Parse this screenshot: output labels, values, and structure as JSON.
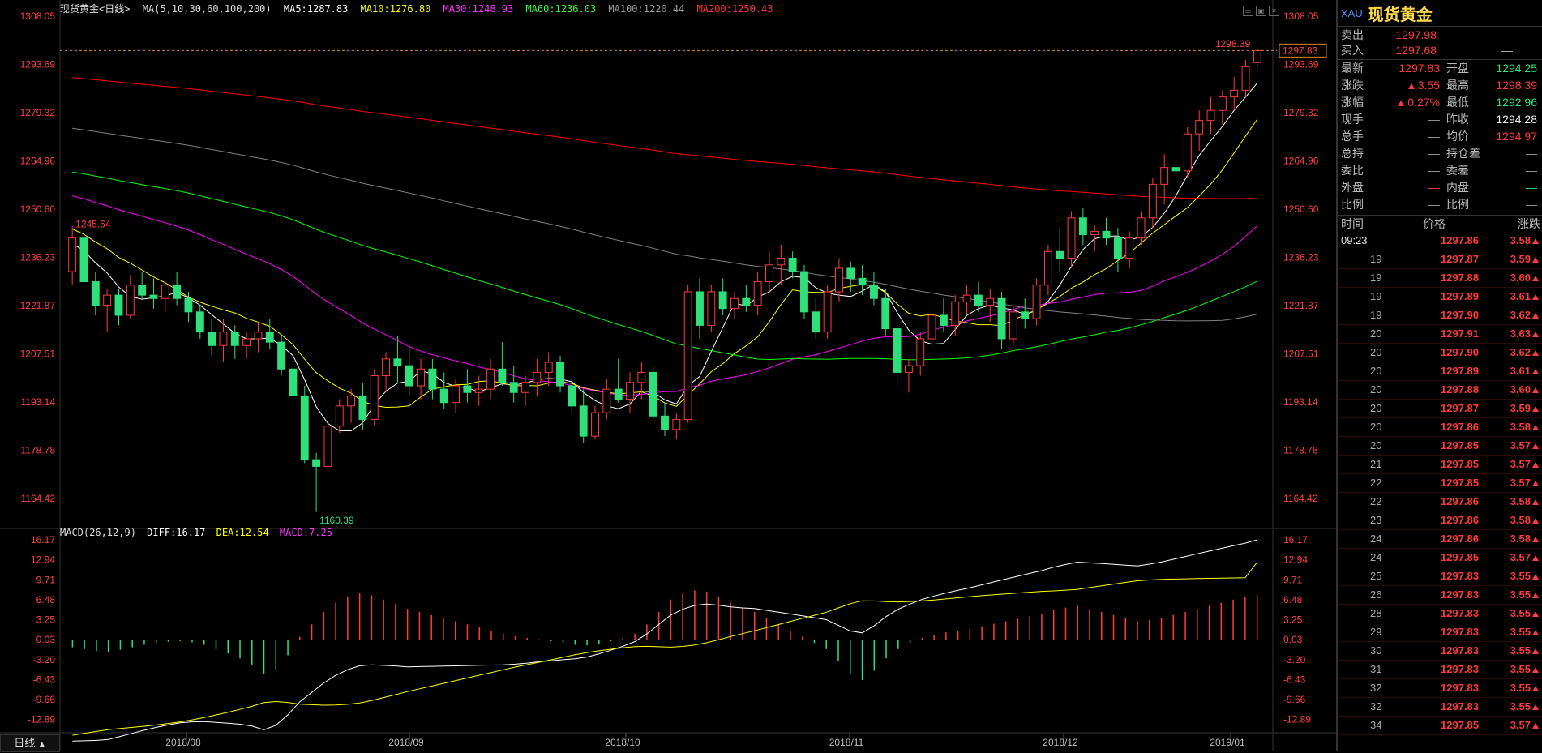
{
  "header": {
    "instrument": "现货黄金<日线>",
    "ma_params": "MA(5,10,30,60,100,200)",
    "ma5": "MA5:1287.83",
    "ma10": "MA10:1276.80",
    "ma30": "MA30:1248.93",
    "ma60": "MA60:1236.03",
    "ma100": "MA100:1220.44",
    "ma200": "MA200:1250.43"
  },
  "price_axis": [
    "1308.05",
    "1293.69",
    "1279.32",
    "1264.96",
    "1250.60",
    "1236.23",
    "1221.87",
    "1207.51",
    "1193.14",
    "1178.78",
    "1164.42"
  ],
  "macd_axis": [
    "16.17",
    "12.94",
    "9.71",
    "6.48",
    "3.25",
    "0.03",
    "-3.20",
    "-6.43",
    "-9.66",
    "-12.89"
  ],
  "date_axis": [
    "2018/08",
    "2018/09",
    "2018/10",
    "2018/11",
    "2018/12",
    "2019/01"
  ],
  "annotations": {
    "high_label": "1298.39",
    "low_label": "1160.39",
    "early_high": "1245.64",
    "last_price_tag": "1297.83"
  },
  "macd_header": {
    "name": "MACD(26,12,9)",
    "diff": "DIFF:16.17",
    "dea": "DEA:12.54",
    "macd": "MACD:7.25"
  },
  "period_button": "日线",
  "colors": {
    "up": "#ff3b3b",
    "down": "#2ee07a",
    "ma5": "#ffffff",
    "ma10": "#ffff00",
    "ma30": "#ff00ff",
    "ma60": "#00ff00",
    "ma100": "#808080",
    "ma200": "#ff0000"
  },
  "panel": {
    "code": "XAU",
    "name": "现货黄金",
    "sell_label": "卖出",
    "sell_price": "1297.98",
    "sell_vol": "—",
    "buy_label": "买入",
    "buy_price": "1297.68",
    "buy_vol": "—",
    "stats": [
      {
        "l1": "最新",
        "v1": "1297.83",
        "c1": "red",
        "l2": "开盘",
        "v2": "1294.25",
        "c2": "green"
      },
      {
        "l1": "涨跌",
        "v1": "3.55",
        "c1": "red",
        "l2": "最高",
        "v2": "1298.39",
        "c2": "red"
      },
      {
        "l1": "涨幅",
        "v1": "0.27%",
        "c1": "red",
        "l2": "最低",
        "v2": "1292.96",
        "c2": "green"
      },
      {
        "l1": "现手",
        "v1": "—",
        "c1": "gray",
        "l2": "昨收",
        "v2": "1294.28",
        "c2": "white"
      },
      {
        "l1": "总手",
        "v1": "—",
        "c1": "gray",
        "l2": "均价",
        "v2": "1294.97",
        "c2": "red"
      },
      {
        "l1": "总持",
        "v1": "—",
        "c1": "gray",
        "l2": "持仓差",
        "v2": "—",
        "c2": "gray"
      },
      {
        "l1": "委比",
        "v1": "—",
        "c1": "gray",
        "l2": "委差",
        "v2": "—",
        "c2": "gray"
      },
      {
        "l1": "外盘",
        "v1": "—",
        "c1": "red",
        "l2": "内盘",
        "v2": "—",
        "c2": "green"
      },
      {
        "l1": "比例",
        "v1": "—",
        "c1": "gray",
        "l2": "比例",
        "v2": "—",
        "c2": "gray"
      }
    ],
    "tick_headers": [
      "时间",
      "价格",
      "涨跌"
    ],
    "ticks": [
      {
        "t": "09:23",
        "p": "1297.86",
        "c": "3.58"
      },
      {
        "t": "19",
        "p": "1297.87",
        "c": "3.59"
      },
      {
        "t": "19",
        "p": "1297.88",
        "c": "3.60"
      },
      {
        "t": "19",
        "p": "1297.89",
        "c": "3.61"
      },
      {
        "t": "19",
        "p": "1297.90",
        "c": "3.62"
      },
      {
        "t": "20",
        "p": "1297.91",
        "c": "3.63"
      },
      {
        "t": "20",
        "p": "1297.90",
        "c": "3.62"
      },
      {
        "t": "20",
        "p": "1297.89",
        "c": "3.61"
      },
      {
        "t": "20",
        "p": "1297.88",
        "c": "3.60"
      },
      {
        "t": "20",
        "p": "1297.87",
        "c": "3.59"
      },
      {
        "t": "20",
        "p": "1297.86",
        "c": "3.58"
      },
      {
        "t": "20",
        "p": "1297.85",
        "c": "3.57"
      },
      {
        "t": "21",
        "p": "1297.85",
        "c": "3.57"
      },
      {
        "t": "22",
        "p": "1297.85",
        "c": "3.57"
      },
      {
        "t": "22",
        "p": "1297.86",
        "c": "3.58"
      },
      {
        "t": "23",
        "p": "1297.86",
        "c": "3.58"
      },
      {
        "t": "24",
        "p": "1297.86",
        "c": "3.58"
      },
      {
        "t": "24",
        "p": "1297.85",
        "c": "3.57"
      },
      {
        "t": "25",
        "p": "1297.83",
        "c": "3.55"
      },
      {
        "t": "26",
        "p": "1297.83",
        "c": "3.55"
      },
      {
        "t": "28",
        "p": "1297.83",
        "c": "3.55"
      },
      {
        "t": "29",
        "p": "1297.83",
        "c": "3.55"
      },
      {
        "t": "30",
        "p": "1297.83",
        "c": "3.55"
      },
      {
        "t": "31",
        "p": "1297.83",
        "c": "3.55"
      },
      {
        "t": "32",
        "p": "1297.83",
        "c": "3.55"
      },
      {
        "t": "32",
        "p": "1297.83",
        "c": "3.55"
      },
      {
        "t": "34",
        "p": "1297.85",
        "c": "3.57"
      }
    ]
  },
  "chart_data": {
    "type": "candlestick",
    "xlabel": "",
    "ylabel": "",
    "ylim": [
      1160,
      1308.05
    ],
    "date_labels": [
      "2018/08",
      "2018/09",
      "2018/10",
      "2018/11",
      "2018/12",
      "2019/01"
    ],
    "ohlc": [
      [
        1232,
        1245.6,
        1228,
        1242
      ],
      [
        1242,
        1244,
        1227,
        1229
      ],
      [
        1229,
        1232,
        1219,
        1222
      ],
      [
        1222,
        1227,
        1214,
        1225
      ],
      [
        1225,
        1227,
        1216,
        1219
      ],
      [
        1219,
        1231,
        1218,
        1228
      ],
      [
        1228,
        1232,
        1224,
        1225
      ],
      [
        1225,
        1230,
        1221,
        1224
      ],
      [
        1224,
        1229,
        1220,
        1228
      ],
      [
        1228,
        1232,
        1222,
        1224
      ],
      [
        1224,
        1226,
        1217,
        1220
      ],
      [
        1220,
        1222,
        1212,
        1214
      ],
      [
        1214,
        1218,
        1207,
        1210
      ],
      [
        1210,
        1218,
        1205,
        1214
      ],
      [
        1214,
        1216,
        1206,
        1210
      ],
      [
        1210,
        1214,
        1206,
        1212
      ],
      [
        1212,
        1217,
        1208,
        1214
      ],
      [
        1214,
        1218,
        1209,
        1211
      ],
      [
        1211,
        1213,
        1201,
        1203
      ],
      [
        1203,
        1207,
        1193,
        1195
      ],
      [
        1195,
        1198,
        1175,
        1176
      ],
      [
        1176,
        1178,
        1160.4,
        1174
      ],
      [
        1174,
        1188,
        1172,
        1186
      ],
      [
        1186,
        1194,
        1184,
        1192
      ],
      [
        1192,
        1197,
        1187,
        1195
      ],
      [
        1195,
        1199,
        1185,
        1188
      ],
      [
        1188,
        1203,
        1186,
        1201
      ],
      [
        1201,
        1208,
        1196,
        1206
      ],
      [
        1206,
        1213,
        1199,
        1204
      ],
      [
        1204,
        1210,
        1195,
        1198
      ],
      [
        1198,
        1206,
        1194,
        1203
      ],
      [
        1203,
        1206,
        1194,
        1197
      ],
      [
        1197,
        1202,
        1191,
        1193
      ],
      [
        1193,
        1200,
        1190,
        1198
      ],
      [
        1198,
        1203,
        1193,
        1196
      ],
      [
        1196,
        1201,
        1192,
        1197
      ],
      [
        1197,
        1206,
        1194,
        1203
      ],
      [
        1203,
        1211,
        1198,
        1199
      ],
      [
        1199,
        1204,
        1193,
        1196
      ],
      [
        1196,
        1201,
        1192,
        1199
      ],
      [
        1199,
        1206,
        1195,
        1202
      ],
      [
        1202,
        1208,
        1198,
        1205
      ],
      [
        1205,
        1207,
        1196,
        1198
      ],
      [
        1198,
        1200,
        1190,
        1192
      ],
      [
        1192,
        1197,
        1181,
        1183
      ],
      [
        1183,
        1192,
        1182,
        1190
      ],
      [
        1190,
        1200,
        1188,
        1197
      ],
      [
        1197,
        1206,
        1193,
        1194
      ],
      [
        1194,
        1202,
        1190,
        1199
      ],
      [
        1199,
        1205,
        1194,
        1202
      ],
      [
        1202,
        1204,
        1188,
        1189
      ],
      [
        1189,
        1193,
        1183,
        1185
      ],
      [
        1185,
        1190,
        1182,
        1188
      ],
      [
        1188,
        1228,
        1187,
        1226
      ],
      [
        1226,
        1230,
        1212,
        1216
      ],
      [
        1216,
        1228,
        1214,
        1226
      ],
      [
        1226,
        1230,
        1219,
        1221
      ],
      [
        1221,
        1226,
        1218,
        1224
      ],
      [
        1224,
        1228,
        1220,
        1222
      ],
      [
        1222,
        1232,
        1219,
        1229
      ],
      [
        1229,
        1238,
        1226,
        1234
      ],
      [
        1234,
        1240,
        1228,
        1236
      ],
      [
        1236,
        1238,
        1230,
        1232
      ],
      [
        1232,
        1234,
        1218,
        1220
      ],
      [
        1220,
        1224,
        1212,
        1214
      ],
      [
        1214,
        1228,
        1212,
        1226
      ],
      [
        1226,
        1236,
        1223,
        1233
      ],
      [
        1233,
        1235,
        1226,
        1230
      ],
      [
        1230,
        1234,
        1225,
        1228
      ],
      [
        1228,
        1232,
        1222,
        1224
      ],
      [
        1224,
        1227,
        1213,
        1215
      ],
      [
        1215,
        1217,
        1198,
        1202
      ],
      [
        1202,
        1206,
        1196,
        1204
      ],
      [
        1204,
        1214,
        1201,
        1212
      ],
      [
        1212,
        1221,
        1209,
        1219
      ],
      [
        1219,
        1224,
        1214,
        1216
      ],
      [
        1216,
        1225,
        1213,
        1223
      ],
      [
        1223,
        1228,
        1219,
        1225
      ],
      [
        1225,
        1229,
        1220,
        1222
      ],
      [
        1222,
        1227,
        1217,
        1224
      ],
      [
        1224,
        1226,
        1209,
        1212
      ],
      [
        1212,
        1222,
        1210,
        1220
      ],
      [
        1220,
        1224,
        1215,
        1218
      ],
      [
        1218,
        1230,
        1216,
        1228
      ],
      [
        1228,
        1240,
        1225,
        1238
      ],
      [
        1238,
        1245,
        1232,
        1236
      ],
      [
        1236,
        1250,
        1233,
        1248
      ],
      [
        1248,
        1251,
        1240,
        1243
      ],
      [
        1243,
        1246,
        1238,
        1244
      ],
      [
        1244,
        1248,
        1240,
        1242
      ],
      [
        1242,
        1245,
        1232,
        1236
      ],
      [
        1236,
        1244,
        1233,
        1242
      ],
      [
        1242,
        1250,
        1240,
        1248
      ],
      [
        1248,
        1260,
        1245,
        1258
      ],
      [
        1258,
        1267,
        1252,
        1263
      ],
      [
        1263,
        1270,
        1259,
        1262
      ],
      [
        1262,
        1275,
        1260,
        1273
      ],
      [
        1273,
        1280,
        1268,
        1277
      ],
      [
        1277,
        1284,
        1273,
        1280
      ],
      [
        1280,
        1286,
        1276,
        1284
      ],
      [
        1284,
        1290,
        1280,
        1286
      ],
      [
        1286,
        1295,
        1284,
        1293
      ],
      [
        1294.25,
        1298.39,
        1292.96,
        1297.83
      ]
    ],
    "macd": {
      "diff_last": 16.17,
      "dea_last": 12.54,
      "macd_last": 7.25,
      "hist": [
        -1.2,
        -1.5,
        -1.8,
        -2.0,
        -1.6,
        -1.2,
        -0.8,
        -0.5,
        -0.3,
        -0.2,
        -0.4,
        -0.8,
        -1.5,
        -2.2,
        -3.0,
        -4.0,
        -5.5,
        -4.8,
        -2.5,
        0.5,
        2.5,
        4.5,
        6.0,
        7.0,
        7.5,
        7.2,
        6.5,
        5.8,
        5.0,
        4.5,
        4.0,
        3.5,
        3.0,
        2.5,
        2.0,
        1.5,
        1.0,
        0.6,
        0.3,
        0.1,
        -0.2,
        -0.5,
        -0.8,
        -0.9,
        -0.6,
        -0.2,
        0.3,
        1.0,
        2.5,
        4.5,
        6.5,
        7.5,
        8.0,
        7.8,
        7.0,
        6.0,
        5.2,
        4.5,
        3.5,
        2.5,
        1.5,
        0.5,
        -0.5,
        -1.5,
        -3.5,
        -5.5,
        -6.5,
        -5.0,
        -3.0,
        -1.5,
        -0.5,
        0.3,
        0.8,
        1.2,
        1.5,
        1.8,
        2.2,
        2.6,
        3.0,
        3.4,
        3.8,
        4.2,
        4.8,
        5.2,
        5.5,
        5.0,
        4.5,
        4.0,
        3.5,
        3.0,
        3.2,
        3.5,
        4.0,
        4.5,
        5.0,
        5.5,
        6.0,
        6.5,
        7.0,
        7.25
      ]
    }
  }
}
